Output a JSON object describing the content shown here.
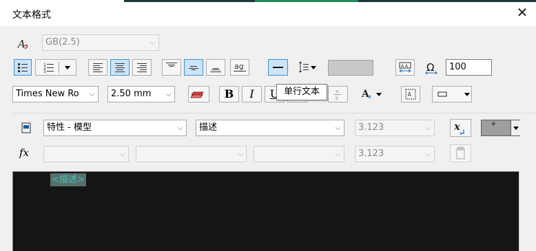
{
  "window": {
    "title": "文本格式",
    "close_glyph": "✕"
  },
  "row1": {
    "style_combo": "GB(2.5)",
    "rotation_value": "100"
  },
  "row2": {
    "font_combo": "Times New Ro",
    "height_combo": "2.50 mm",
    "bold_label": "B",
    "italic_label": "I",
    "underline_label": "U",
    "tooltip": "单行文本"
  },
  "row3": {
    "field_source_combo": "特性 - 模型",
    "field_prop_combo": "描述",
    "format_combo": "3.123",
    "degree_combo": "°"
  },
  "row4": {
    "format_combo": "3.123",
    "fx_label": "fx"
  },
  "editor": {
    "field_text": "<描述>"
  },
  "icons": {
    "text-style-icon": "A-script",
    "bullets-icon": "bullet-list",
    "numbering-icon": "numbered-list",
    "align-left-icon": "align-left",
    "align-center-icon": "align-center",
    "align-right-icon": "align-right",
    "line-spacing-icon": "line-spacing",
    "omega-icon": "omega"
  },
  "colors": {
    "accent": "#3f8fd6",
    "editor_bg": "#151515",
    "field_fg": "#48c5b4",
    "field_bg": "#566f6d"
  }
}
